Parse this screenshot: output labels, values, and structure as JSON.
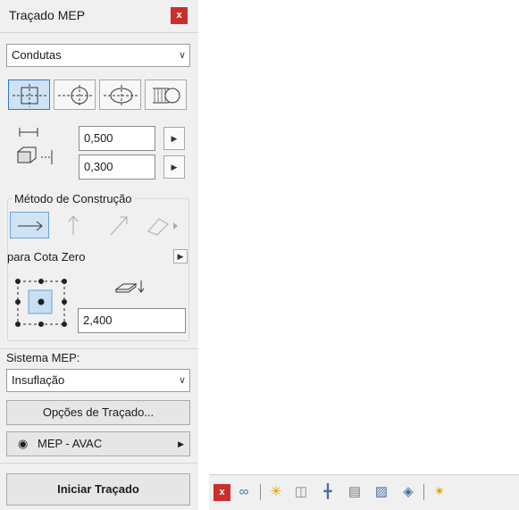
{
  "palette": {
    "title": "Traçado MEP",
    "close_label": "x",
    "type_select": "Condutas",
    "width_value": "0,500",
    "height_value": "0,300",
    "construction_group_label": "Método de Construção",
    "zero_label": "para Cota Zero",
    "elevation_value": "2,400",
    "system_label": "Sistema MEP:",
    "system_select": "Insuflação",
    "options_button": "Opções de Traçado...",
    "layer_label": "MEP - AVAC",
    "start_button": "Iniciar Traçado"
  },
  "toolbar": {
    "close_label": "x",
    "icons": [
      "routing-link-icon",
      "snap-star-icon",
      "add-segment-icon",
      "insert-branch-icon",
      "select-segment-icon",
      "edit-route-icon",
      "route-3d-icon",
      "settings-star-icon"
    ]
  },
  "colors": {
    "close": "#c9302c",
    "selected": "#cfe3f5",
    "accent": "#2e7bc4"
  }
}
